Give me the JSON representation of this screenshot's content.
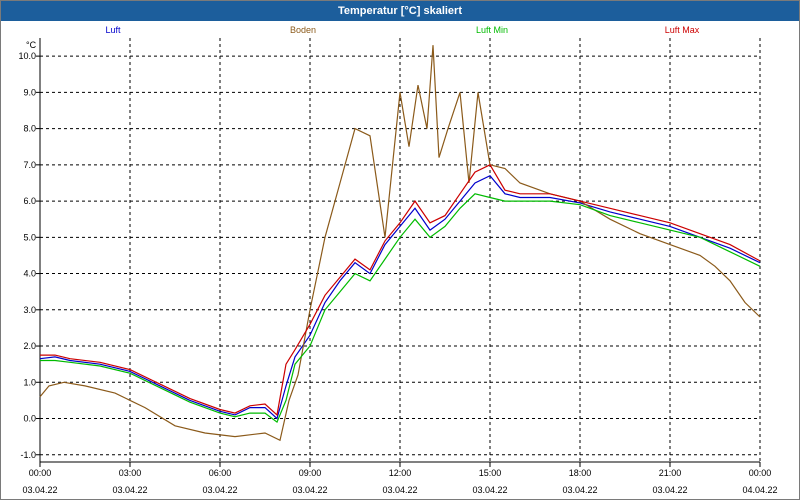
{
  "window": {
    "title": "Temperatur [°C] skaliert"
  },
  "chart_data": {
    "type": "line",
    "title": "Temperatur [°C] skaliert",
    "ylabel": "°C",
    "ylim": [
      -1.0,
      10.5
    ],
    "yticks": [
      "10.0",
      "9.0",
      "8.0",
      "7.0",
      "6.0",
      "5.0",
      "4.0",
      "3.0",
      "2.0",
      "1.0",
      "0.0",
      "-1.0"
    ],
    "xlim": [
      0,
      24
    ],
    "xticks": [
      {
        "time": "00:00",
        "date": "03.04.22"
      },
      {
        "time": "03:00",
        "date": "03.04.22"
      },
      {
        "time": "06:00",
        "date": "03.04.22"
      },
      {
        "time": "09:00",
        "date": "03.04.22"
      },
      {
        "time": "12:00",
        "date": "03.04.22"
      },
      {
        "time": "15:00",
        "date": "03.04.22"
      },
      {
        "time": "18:00",
        "date": "03.04.22"
      },
      {
        "time": "21:00",
        "date": "03.04.22"
      },
      {
        "time": "00:00",
        "date": "04.04.22"
      }
    ],
    "grid": true,
    "legend_position": "top",
    "series": [
      {
        "name": "Luft",
        "color": "#0000cc",
        "x": [
          0,
          0.5,
          1,
          2,
          3,
          4,
          5,
          6,
          6.5,
          7,
          7.5,
          7.9,
          8.2,
          8.5,
          9,
          9.5,
          10,
          10.5,
          11,
          11.5,
          12,
          12.5,
          13,
          13.5,
          14,
          14.5,
          15,
          15.5,
          16,
          17,
          18,
          19,
          20,
          21,
          22,
          23,
          24
        ],
        "y": [
          1.65,
          1.7,
          1.6,
          1.5,
          1.3,
          0.9,
          0.5,
          0.2,
          0.1,
          0.3,
          0.3,
          0.0,
          0.9,
          1.7,
          2.3,
          3.2,
          3.8,
          4.3,
          4.0,
          4.8,
          5.3,
          5.8,
          5.2,
          5.5,
          6.0,
          6.5,
          6.7,
          6.2,
          6.1,
          6.1,
          5.95,
          5.7,
          5.5,
          5.3,
          5.0,
          4.7,
          4.3
        ]
      },
      {
        "name": "Boden",
        "color": "#8b5a1a",
        "x": [
          0,
          0.3,
          0.8,
          1.5,
          2.5,
          3.5,
          4.5,
          5.5,
          6.5,
          7.5,
          8,
          8.3,
          8.6,
          9,
          9.5,
          10,
          10.5,
          11,
          11.5,
          12,
          12.3,
          12.6,
          12.9,
          13.1,
          13.3,
          13.6,
          14,
          14.3,
          14.6,
          15,
          15.5,
          16,
          17,
          18,
          19,
          20,
          21,
          22,
          22.5,
          23,
          23.5,
          24
        ],
        "y": [
          0.6,
          0.9,
          1.0,
          0.9,
          0.7,
          0.3,
          -0.2,
          -0.4,
          -0.5,
          -0.4,
          -0.6,
          0.5,
          1.2,
          3.0,
          5.0,
          6.5,
          8.0,
          7.8,
          5.0,
          9.0,
          7.5,
          9.2,
          8.0,
          10.3,
          7.2,
          8.0,
          9.0,
          6.5,
          9.0,
          7.0,
          6.9,
          6.5,
          6.2,
          6.0,
          5.5,
          5.1,
          4.8,
          4.5,
          4.2,
          3.8,
          3.2,
          2.8
        ]
      },
      {
        "name": "Luft Min",
        "color": "#00bb00",
        "x": [
          0,
          0.5,
          1,
          2,
          3,
          4,
          5,
          6,
          6.5,
          7,
          7.5,
          7.9,
          8.2,
          8.5,
          9,
          9.5,
          10,
          10.5,
          11,
          11.5,
          12,
          12.5,
          13,
          13.5,
          14,
          14.5,
          15,
          15.5,
          16,
          17,
          18,
          19,
          20,
          21,
          22,
          23,
          24
        ],
        "y": [
          1.6,
          1.6,
          1.55,
          1.45,
          1.25,
          0.85,
          0.45,
          0.15,
          0.05,
          0.15,
          0.15,
          -0.1,
          0.5,
          1.5,
          2.0,
          3.0,
          3.5,
          4.0,
          3.8,
          4.4,
          5.0,
          5.5,
          5.0,
          5.3,
          5.8,
          6.2,
          6.1,
          6.0,
          6.0,
          6.0,
          5.9,
          5.6,
          5.4,
          5.2,
          5.0,
          4.6,
          4.2
        ]
      },
      {
        "name": "Luft Max",
        "color": "#cc0000",
        "x": [
          0,
          0.5,
          1,
          2,
          3,
          4,
          5,
          6,
          6.5,
          7,
          7.5,
          7.9,
          8.2,
          8.5,
          9,
          9.5,
          10,
          10.5,
          11,
          11.5,
          12,
          12.5,
          13,
          13.5,
          14,
          14.5,
          15,
          15.5,
          16,
          17,
          18,
          19,
          20,
          21,
          22,
          23,
          24
        ],
        "y": [
          1.75,
          1.75,
          1.65,
          1.55,
          1.35,
          0.95,
          0.55,
          0.25,
          0.15,
          0.35,
          0.4,
          0.1,
          1.5,
          1.9,
          2.6,
          3.4,
          3.9,
          4.4,
          4.1,
          4.9,
          5.4,
          6.0,
          5.4,
          5.6,
          6.2,
          6.8,
          7.0,
          6.3,
          6.2,
          6.2,
          6.0,
          5.8,
          5.6,
          5.4,
          5.1,
          4.8,
          4.35
        ]
      }
    ]
  }
}
